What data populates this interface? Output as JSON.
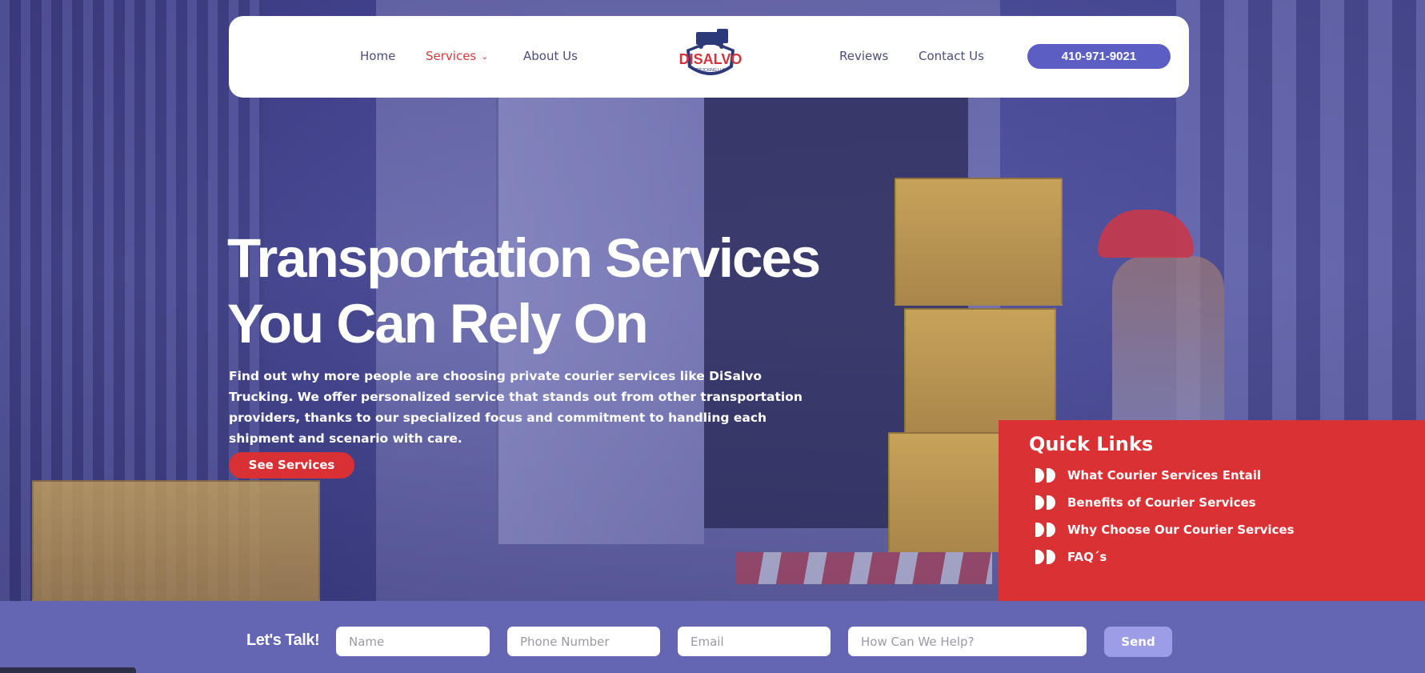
{
  "header": {
    "nav": {
      "home": "Home",
      "services": "Services",
      "about": "About Us",
      "reviews": "Reviews",
      "contact": "Contact Us"
    },
    "logo_text": "DISALVO",
    "phone": "410-971-9021"
  },
  "hero": {
    "title_line1": "Transportation Services",
    "title_line2": "You Can Rely On",
    "description": "Find out why more people are choosing private courier services like DiSalvo Trucking. We offer personalized service that stands out from other transportation providers, thanks to our specialized focus and commitment to handling each shipment and scenario with care.",
    "cta": "See Services"
  },
  "quick_links": {
    "title": "Quick Links",
    "items": [
      "What Courier Services Entail",
      "Benefits of Courier Services",
      "Why Choose Our Courier Services",
      "FAQ´s"
    ]
  },
  "contact_bar": {
    "heading": "Let's Talk!",
    "name_placeholder": "Name",
    "phone_placeholder": "Phone Number",
    "email_placeholder": "Email",
    "help_placeholder": "How Can We Help?",
    "send": "Send"
  },
  "colors": {
    "accent_blue": "#5d5ec3",
    "accent_red": "#d93134",
    "form_bar": "#6566b3"
  }
}
